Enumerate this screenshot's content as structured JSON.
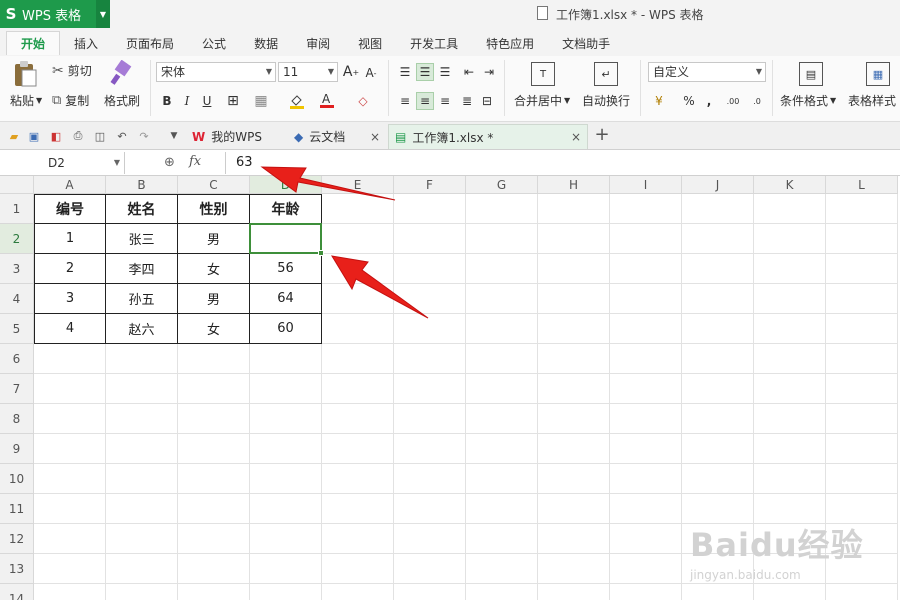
{
  "app": {
    "name": "WPS 表格",
    "window_title": "工作簿1.xlsx * - WPS 表格",
    "accent": "#1e9a4b"
  },
  "menu_tabs": [
    {
      "label": "开始",
      "active": true
    },
    {
      "label": "插入"
    },
    {
      "label": "页面布局"
    },
    {
      "label": "公式"
    },
    {
      "label": "数据"
    },
    {
      "label": "审阅"
    },
    {
      "label": "视图"
    },
    {
      "label": "开发工具"
    },
    {
      "label": "特色应用"
    },
    {
      "label": "文档助手"
    }
  ],
  "ribbon": {
    "paste": "粘贴",
    "cut": "剪切",
    "copy": "复制",
    "format_painter": "格式刷",
    "font_name": "宋体",
    "font_size": "11",
    "merge_center": "合并居中",
    "wrap_text": "自动换行",
    "number_format": "自定义",
    "conditional_format": "条件格式",
    "table_style": "表格样式"
  },
  "doc_tabs": [
    {
      "label": "我的WPS"
    },
    {
      "label": "云文档"
    },
    {
      "label": "工作簿1.xlsx *",
      "active": true
    }
  ],
  "formula_bar": {
    "cell_ref": "D2",
    "value": "63"
  },
  "sheet": {
    "columns": [
      "A",
      "B",
      "C",
      "D",
      "E",
      "F",
      "G",
      "H",
      "I",
      "J",
      "K",
      "L"
    ],
    "rows": [
      "1",
      "2",
      "3",
      "4",
      "5",
      "6",
      "7",
      "8",
      "9",
      "10",
      "11",
      "12",
      "13",
      "14"
    ],
    "selected_col": "D",
    "selected_row": "2",
    "table": [
      [
        "编号",
        "姓名",
        "性别",
        "年龄"
      ],
      [
        "1",
        "张三",
        "男",
        ""
      ],
      [
        "2",
        "李四",
        "女",
        "56"
      ],
      [
        "3",
        "孙五",
        "男",
        "64"
      ],
      [
        "4",
        "赵六",
        "女",
        "60"
      ]
    ]
  },
  "watermark": {
    "brand": "Baidu经验",
    "url": "jingyan.baidu.com"
  }
}
